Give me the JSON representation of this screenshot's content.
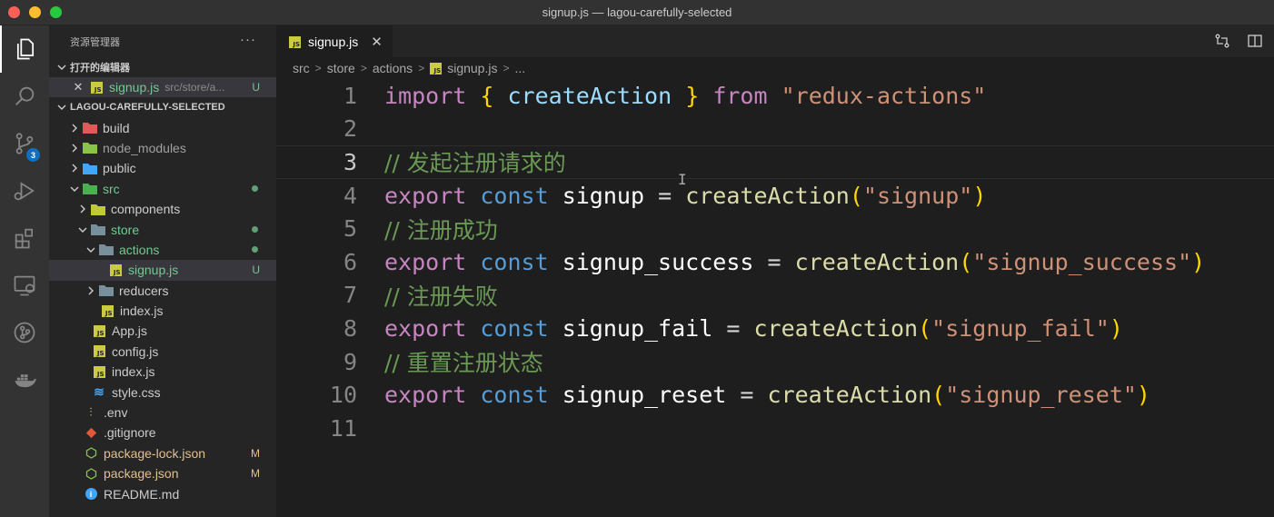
{
  "window": {
    "title": "signup.js — lagou-carefully-selected"
  },
  "activity_bar": {
    "items": [
      {
        "name": "files-icon"
      },
      {
        "name": "search-icon"
      },
      {
        "name": "source-control-icon",
        "badge": "3"
      },
      {
        "name": "run-debug-icon"
      },
      {
        "name": "extensions-icon"
      },
      {
        "name": "remote-explorer-icon"
      },
      {
        "name": "git-graph-icon"
      },
      {
        "name": "docker-icon"
      }
    ]
  },
  "sidebar": {
    "title": "资源管理器",
    "more": "···",
    "open_editors": {
      "label": "打开的编辑器",
      "items": [
        {
          "name": "signup.js",
          "path": "src/store/a...",
          "status": "U"
        }
      ]
    },
    "project": {
      "label": "LAGOU-CAREFULLY-SELECTED",
      "tree": [
        {
          "label": "build"
        },
        {
          "label": "node_modules"
        },
        {
          "label": "public"
        },
        {
          "label": "src"
        },
        {
          "label": "components"
        },
        {
          "label": "store"
        },
        {
          "label": "actions"
        },
        {
          "label": "signup.js",
          "status": "U"
        },
        {
          "label": "reducers"
        },
        {
          "label": "index.js"
        },
        {
          "label": "App.js"
        },
        {
          "label": "config.js"
        },
        {
          "label": "index.js"
        },
        {
          "label": "style.css"
        },
        {
          "label": ".env"
        },
        {
          "label": ".gitignore"
        },
        {
          "label": "package-lock.json",
          "status": "M"
        },
        {
          "label": "package.json",
          "status": "M"
        },
        {
          "label": "README.md"
        }
      ]
    }
  },
  "tabs": [
    {
      "label": "signup.js",
      "close": "✕"
    }
  ],
  "breadcrumb": {
    "parts": [
      "src",
      "store",
      "actions",
      "signup.js",
      "..."
    ]
  },
  "editor": {
    "line_numbers": [
      "1",
      "2",
      "3",
      "4",
      "5",
      "6",
      "7",
      "8",
      "9",
      "10",
      "11"
    ],
    "lines": {
      "l1": {
        "kw": "import",
        "open": "{",
        "name": "createAction",
        "close": "}",
        "from": "from",
        "str": "\"redux-actions\""
      },
      "l3": {
        "comment": "// 发起注册请求的"
      },
      "l4": {
        "kw": "export",
        "const": "const",
        "name": "signup",
        "eq": "=",
        "fn": "createAction",
        "open": "(",
        "str": "\"signup\"",
        "close": ")"
      },
      "l5": {
        "comment": "// 注册成功"
      },
      "l6": {
        "kw": "export",
        "const": "const",
        "name": "signup_success",
        "eq": "=",
        "fn": "createAction",
        "open": "(",
        "str": "\"signup_success\"",
        "close": ")"
      },
      "l7": {
        "comment": "// 注册失败"
      },
      "l8": {
        "kw": "export",
        "const": "const",
        "name": "signup_fail",
        "eq": "=",
        "fn": "createAction",
        "open": "(",
        "str": "\"signup_fail\"",
        "close": ")"
      },
      "l9": {
        "comment": "// 重置注册状态"
      },
      "l10": {
        "kw": "export",
        "const": "const",
        "name": "signup_reset",
        "eq": "=",
        "fn": "createAction",
        "open": "(",
        "str": "\"signup_reset\"",
        "close": ")"
      }
    }
  },
  "colors": {
    "folder_red": "#e05a5a",
    "folder_green": "#8bc34a",
    "folder_blue": "#42a5f5",
    "folder_teal": "#4db6ac",
    "git_orange": "#e05a3a",
    "info_blue": "#42a5f5"
  }
}
